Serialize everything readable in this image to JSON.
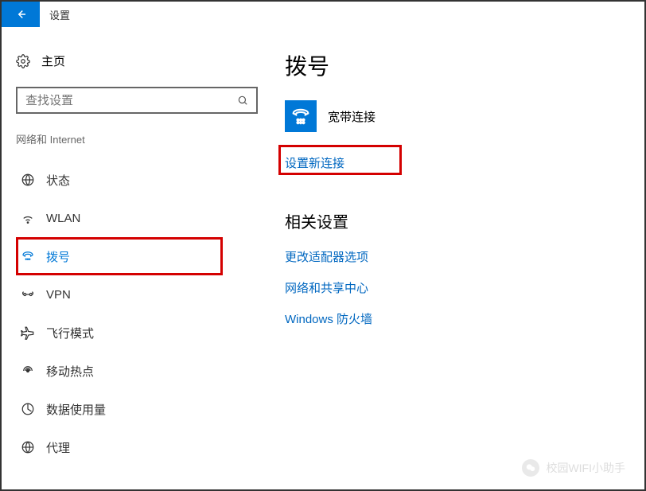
{
  "window": {
    "title": "设置"
  },
  "sidebar": {
    "home": "主页",
    "search_placeholder": "查找设置",
    "category": "网络和 Internet",
    "items": [
      {
        "label": "状态",
        "icon": "globe"
      },
      {
        "label": "WLAN",
        "icon": "wifi"
      },
      {
        "label": "拨号",
        "icon": "dialup",
        "selected": true
      },
      {
        "label": "VPN",
        "icon": "vpn"
      },
      {
        "label": "飞行模式",
        "icon": "airplane"
      },
      {
        "label": "移动热点",
        "icon": "hotspot"
      },
      {
        "label": "数据使用量",
        "icon": "datausage"
      },
      {
        "label": "代理",
        "icon": "proxy"
      }
    ]
  },
  "main": {
    "title": "拨号",
    "connection": "宽带连接",
    "new_connection": "设置新连接",
    "related_title": "相关设置",
    "related": [
      "更改适配器选项",
      "网络和共享中心",
      "Windows 防火墙"
    ]
  },
  "watermark": "校园WIFI小助手"
}
